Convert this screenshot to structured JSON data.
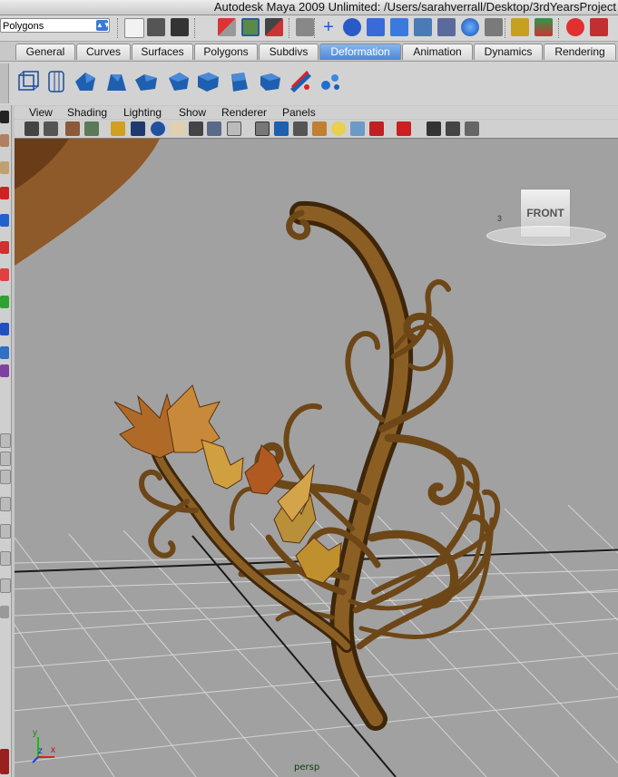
{
  "window": {
    "title": "Autodesk Maya 2009 Unlimited: /Users/sarahverrall/Desktop/3rdYearsProject"
  },
  "toolbar": {
    "menu_set": "Polygons"
  },
  "shelf_tabs": [
    {
      "label": "General",
      "active": false
    },
    {
      "label": "Curves",
      "active": false
    },
    {
      "label": "Surfaces",
      "active": false
    },
    {
      "label": "Polygons",
      "active": false
    },
    {
      "label": "Subdivs",
      "active": false
    },
    {
      "label": "Deformation",
      "active": true
    },
    {
      "label": "Animation",
      "active": false
    },
    {
      "label": "Dynamics",
      "active": false
    },
    {
      "label": "Rendering",
      "active": false
    }
  ],
  "panel_menu": [
    "View",
    "Shading",
    "Lighting",
    "Show",
    "Renderer",
    "Panels"
  ],
  "viewport": {
    "camera_label": "persp",
    "view_cube_label": "FRONT",
    "view_cube_side": "3",
    "axis_labels": {
      "x": "x",
      "y": "y",
      "z": "z"
    }
  },
  "colors": {
    "viewport_bg": "#a1a1a1",
    "grid_line": "#d8d8d8",
    "grid_axis": "#202020",
    "shelf_active": "#4d86d6",
    "vine_dark": "#4a2f0d",
    "vine_mid": "#8a5e22",
    "leaf": "#b8782e"
  }
}
